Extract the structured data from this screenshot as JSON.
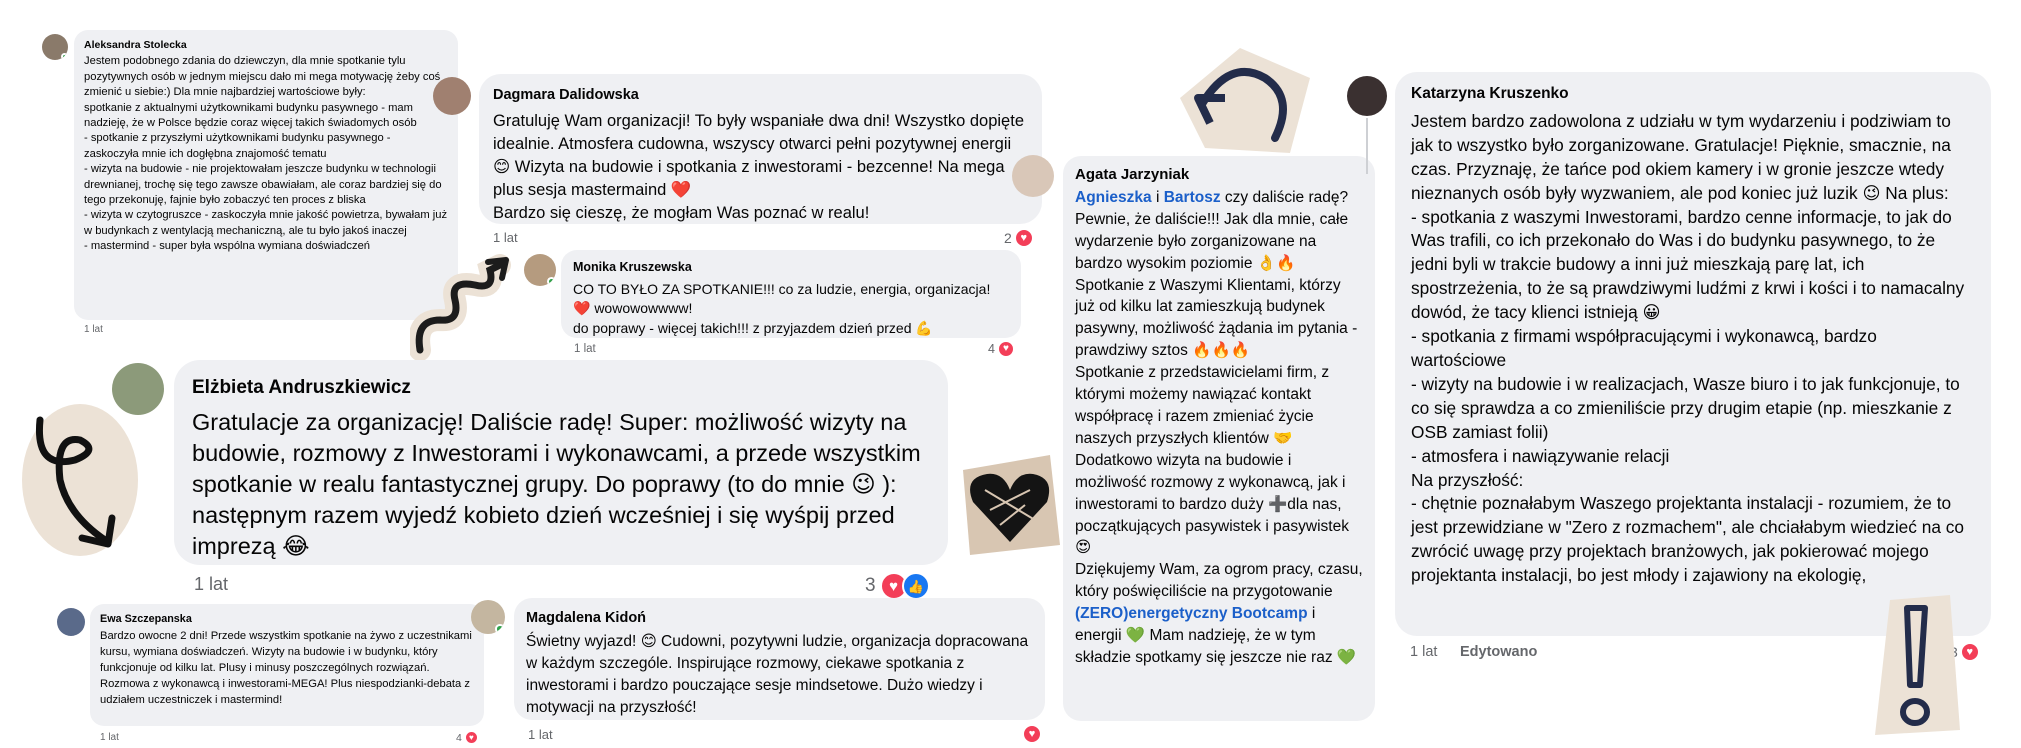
{
  "comments": {
    "stolecka": {
      "author": "Aleksandra Stolecka",
      "text": "Jestem podobnego zdania do dziewczyn, dla mnie spotkanie tylu pozytywnych osób w jednym miejscu dało mi mega motywację żeby coś zmienić u siebie:) Dla mnie najbardziej wartościowe były:\nspotkanie z aktualnymi użytkownikami budynku pasywnego - mam nadzieję, że w Polsce będzie coraz więcej takich świadomych osób\n- spotkanie z przyszłymi użytkownikami budynku pasywnego - zaskoczyła mnie ich dogłębna znajomość tematu\n- wizyta na budowie - nie projektowałam jeszcze budynku w technologii drewnianej, trochę się tego zawsze obawiałam, ale coraz bardziej się do tego przekonuję, fajnie było zobaczyć ten proces z bliska\n- wizyta w czytogruszce - zaskoczyła mnie jakość powietrza, bywałam już w budynkach z wentylacją mechaniczną, ale tu było jakoś inaczej\n- mastermind - super była wspólna wymiana doświadczeń",
      "time": "1 lat"
    },
    "dalidowska": {
      "author": "Dagmara Dalidowska",
      "text": "Gratuluję Wam organizacji! To były wspaniałe dwa dni! Wszystko dopięte idealnie. Atmosfera cudowna, wszyscy otwarci pełni pozytywnej energii 😊 Wizyta na budowie i spotkania z inwestorami - bezcenne! Na mega plus sesja mastermaind ❤️\nBardzo się cieszę, że mogłam Was poznać w realu!",
      "time": "1 lat",
      "reactions": "2"
    },
    "kruszewska": {
      "author": "Monika Kruszewska",
      "text": "CO TO BYŁO ZA SPOTKANIE!!! co za ludzie, energia, organizacja! ❤️ wowowowwww!\ndo poprawy - więcej takich!!! z przyjazdem dzień przed 💪",
      "time": "1 lat",
      "reactions": "4"
    },
    "andruszkiewicz": {
      "author": "Elżbieta Andruszkiewicz",
      "text": "Gratulacje za organizację! Daliście radę! Super: możliwość wizyty na budowie, rozmowy z Inwestorami i wykonawcami, a przede wszystkim spotkanie w realu fantastycznej grupy. Do poprawy (to do mnie 😉 ): następnym razem wyjedź kobieto dzień wcześniej i się wyśpij przed imprezą 😂",
      "time": "1 lat",
      "reactions": "3"
    },
    "szczepanska": {
      "author": "Ewa Szczepanska",
      "text": "Bardzo owocne 2 dni! Przede wszystkim spotkanie na żywo z uczestnikami kursu, wymiana doświadczeń. Wizyty na budowie i w budynku, który funkcjonuje od kilku lat. Plusy i minusy poszczególnych rozwiązań. Rozmowa z wykonawcą i inwestorami-MEGA! Plus niespodzianki-debata z udziałem uczestniczek i mastermind!",
      "time": "1 lat",
      "reactions": "4"
    },
    "kidon": {
      "author": "Magdalena Kidoń",
      "text": "Świetny wyjazd! 😊 Cudowni, pozytywni ludzie, organizacja dopracowana w każdym szczególe. Inspirujące rozmowy, ciekawe spotkania z inwestorami i bardzo pouczające sesje mindsetowe. Dużo wiedzy i motywacji na przyszłość!",
      "time": "1 lat"
    },
    "jarzyniak": {
      "author": "Agata Jarzyniak",
      "mention1": "Agnieszka",
      "joiner": " i ",
      "mention2": "Bartosz",
      "text_a": " czy daliście radę? Pewnie, że daliście!!! Jak dla mnie, całe wydarzenie było zorganizowane na bardzo wysokim poziomie 👌🔥 Spotkanie z Waszymi Klientami, którzy już od kilku lat zamieszkują budynek pasywny, możliwość żądania im pytania - prawdziwy sztos 🔥🔥🔥\nSpotkanie z przedstawicielami firm, z którymi możemy nawiązać kontakt współpracę i razem zmieniać życie naszych przyszłych klientów 🤝\nDodatkowo wizyta na budowie i możliwość rozmowy z wykonawcą, jak i inwestorami to bardzo duży ➕dla nas, początkujących pasywistek i pasywistek 😍\nDziękujemy Wam, za ogrom pracy, czasu, który poświęciliście na przygotowanie ",
      "mention3": "(ZERO)energetyczny Bootcamp",
      "text_b": " i energii 💚 Mam nadzieję, że w tym składzie spotkamy się jeszcze nie raz 💚"
    },
    "kruszenko": {
      "author": "Katarzyna Kruszenko",
      "text": "Jestem bardzo zadowolona z udziału w tym wydarzeniu i podziwiam to jak to wszystko było zorganizowane. Gratulacje! Pięknie, smacznie, na czas. Przyznaję, że tańce pod okiem kamery i w gronie jeszcze wtedy nieznanych osób były wyzwaniem, ale pod koniec już luzik 😉 Na plus:\n- spotkania z waszymi Inwestorami, bardzo cenne informacje, to jak do Was trafili, co ich przekonało do Was i do budynku pasywnego, to że jedni byli w trakcie budowy a inni już mieszkają parę lat, ich spostrzeżenia, to że są prawdziwymi ludźmi z krwi i kości i to namacalny dowód, że tacy klienci istnieją 😀\n- spotkania z firmami współpracującymi i wykonawcą, bardzo wartościowe\n- wizyty na budowie i w realizacjach, Wasze biuro i to jak funkcjonuje, to co się sprawdza a co zmieniliście przy drugim etapie (np. mieszkanie z OSB zamiast folii)\n- atmosfera i nawiązywanie relacji\nNa przyszłość:\n- chętnie poznałabym Waszego projektanta instalacji - rozumiem, że to jest przewidziane w \"Zero z rozmachem\", ale chciałabym wiedzieć na co zwrócić uwagę przy projektach branżowych, jak pokierować mojego projektanta instalacji, bo jest młody i zajawiony na ekologię,",
      "time": "1 lat",
      "edited": "Edytowano",
      "reactions": "3"
    }
  },
  "icons": {
    "heart": "♥",
    "like": "👍"
  },
  "colors": {
    "bubble": "#eff0f3",
    "mention": "#1b5fc9",
    "heart": "#f33e58",
    "like": "#1877f2"
  }
}
